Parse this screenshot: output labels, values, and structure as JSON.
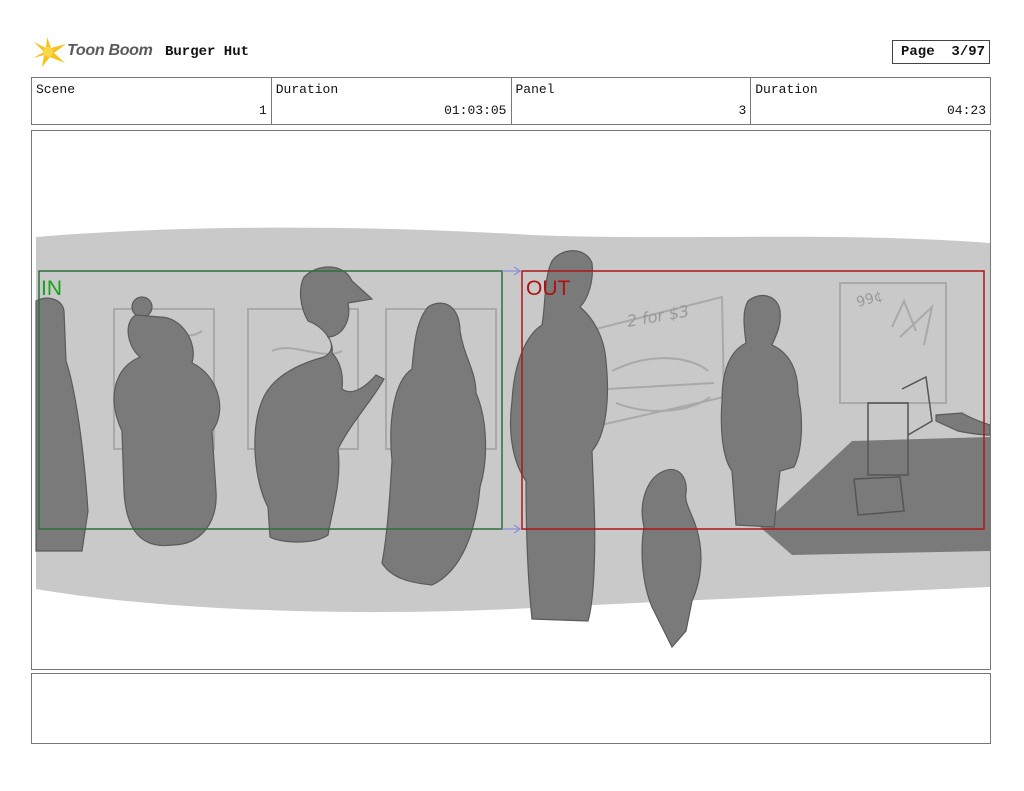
{
  "header": {
    "logo_name": "Toon Boom",
    "project_title": "Burger Hut",
    "page_label": "Page",
    "page_value": "3/97"
  },
  "info": {
    "scene_label": "Scene",
    "scene_value": "1",
    "scene_duration_label": "Duration",
    "scene_duration_value": "01:03:05",
    "panel_label": "Panel",
    "panel_value": "3",
    "panel_duration_label": "Duration",
    "panel_duration_value": "04:23"
  },
  "panel": {
    "in_label": "IN",
    "out_label": "OUT",
    "sketch_text_menu": "2 for $3",
    "sketch_text_poster": "99¢",
    "colors": {
      "in_frame": "#2f6e3f",
      "out_frame": "#b01414",
      "silhouette": "#7a7a7a",
      "wall": "#c8c8c8"
    }
  },
  "notes": {
    "text": ""
  }
}
